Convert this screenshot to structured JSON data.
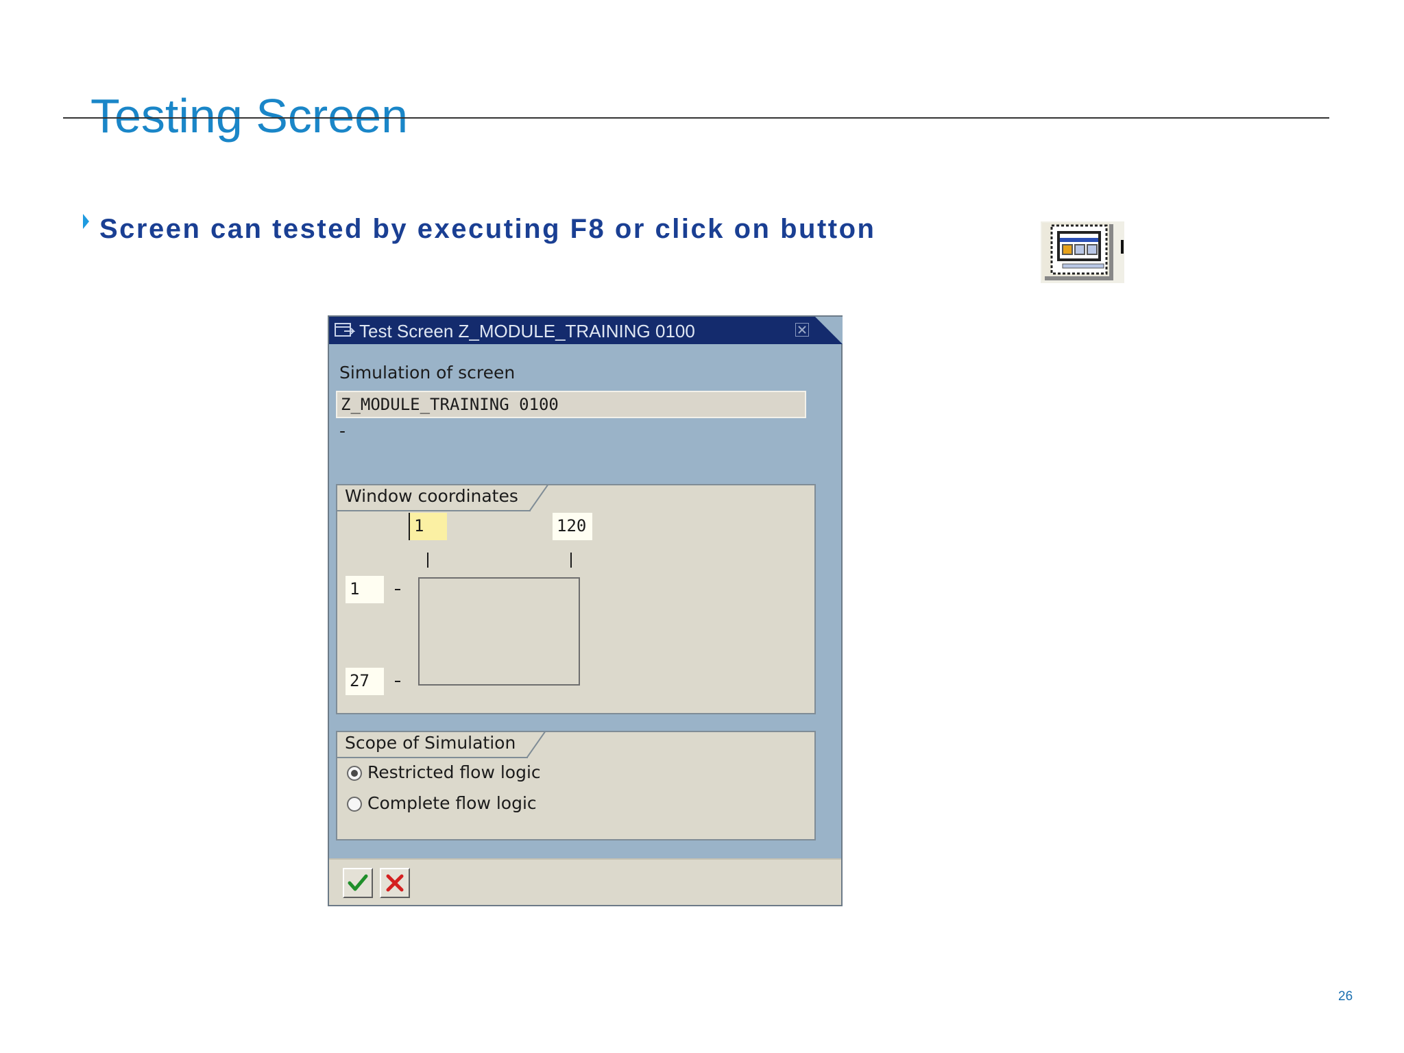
{
  "slide": {
    "title": "Testing Screen",
    "bullet": "Screen can tested by executing F8 or click on button",
    "page_number": "26",
    "toolbar_icon": "test-screen-icon"
  },
  "dialog": {
    "title": "Test Screen Z_MODULE_TRAINING 0100",
    "simulation_label": "Simulation of screen",
    "screen_value": "Z_MODULE_TRAINING 0100",
    "description": "-",
    "window_coordinates": {
      "label": "Window coordinates",
      "column_start": "1",
      "column_end": "120",
      "row_start": "1",
      "row_end": "27"
    },
    "scope": {
      "label": "Scope of Simulation",
      "options": [
        {
          "label": "Restricted flow logic",
          "selected": true
        },
        {
          "label": "Complete flow logic",
          "selected": false
        }
      ]
    },
    "footer": {
      "confirm_icon": "checkmark-icon",
      "cancel_icon": "cancel-x-icon"
    }
  },
  "colors": {
    "title": "#1a86c8",
    "bullet_text": "#1a3f93",
    "dialog_titlebar": "#142b6d",
    "dialog_background": "#9ab3c8",
    "group_background": "#dcd9cc",
    "active_input": "#fbf0a3"
  }
}
